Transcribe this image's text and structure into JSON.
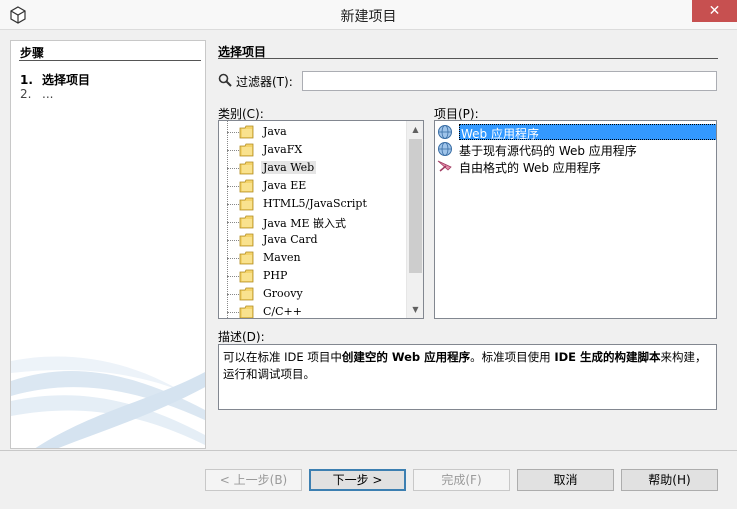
{
  "window": {
    "title": "新建项目",
    "close": "✕"
  },
  "steps": {
    "title": "步骤",
    "items": [
      {
        "num": "1.",
        "label": "选择项目"
      },
      {
        "num": "2.",
        "label": "..."
      }
    ]
  },
  "main": {
    "title": "选择项目",
    "filter": {
      "label": "过滤器(T):",
      "value": ""
    },
    "categories_label": "类别(C):",
    "projects_label": "项目(P):",
    "categories": [
      "Java",
      "JavaFX",
      "Java Web",
      "Java EE",
      "HTML5/JavaScript",
      "Java ME 嵌入式",
      "Java Card",
      "Maven",
      "PHP",
      "Groovy",
      "C/C++"
    ],
    "selected_category": "Java Web",
    "projects": [
      "Web 应用程序",
      "基于现有源代码的 Web 应用程序",
      "自由格式的 Web 应用程序"
    ],
    "selected_project": "Web 应用程序",
    "description_label": "描述(D):",
    "description": {
      "p1": "可以在标准 IDE 项目中",
      "b1": "创建空的 Web 应用程序",
      "p2": "。标准项目使用 ",
      "b2": "IDE 生成的构建脚本",
      "p3": "来构建，运行和调试项目。"
    }
  },
  "buttons": {
    "back": "< 上一步(B)",
    "next": "下一步 >",
    "finish": "完成(F)",
    "cancel": "取消",
    "help": "帮助(H)"
  },
  "colors": {
    "selection": "#3399ff",
    "close": "#c75050"
  }
}
